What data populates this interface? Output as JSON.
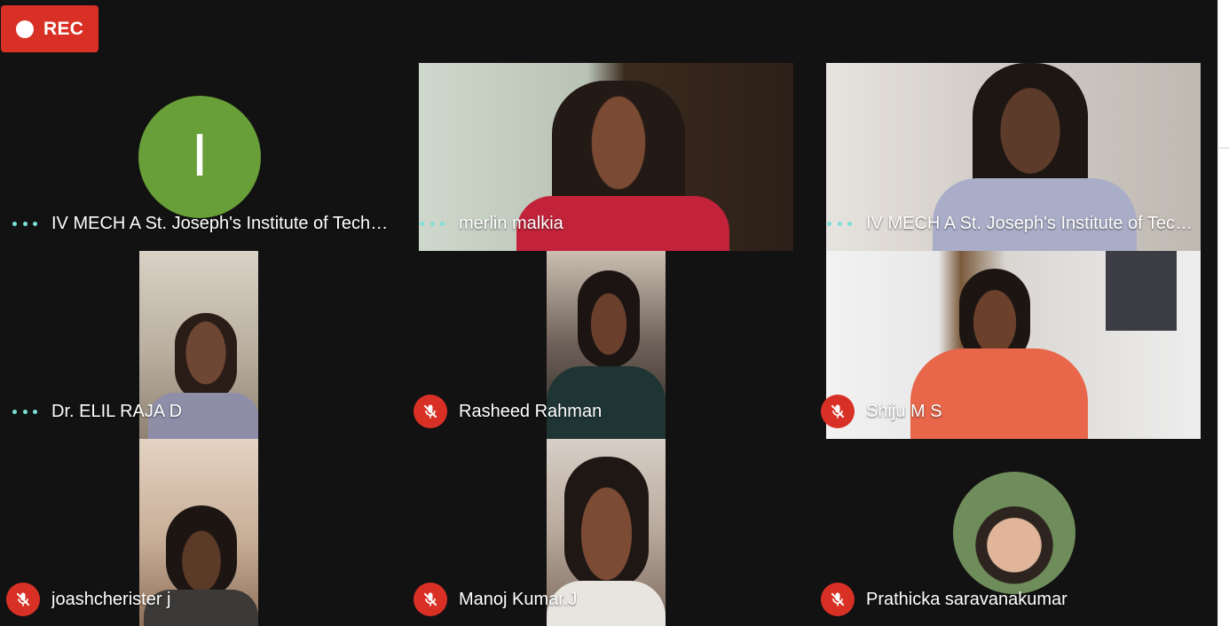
{
  "recording": {
    "label": "REC"
  },
  "tiles": [
    {
      "name": "IV MECH A St. Joseph's Institute of Technology",
      "control": "more",
      "avatar_letter": "I"
    },
    {
      "name": "merlin malkia",
      "control": "more"
    },
    {
      "name": "IV MECH A St. Joseph's Institute of Technology",
      "control": "more"
    },
    {
      "name": "Dr. ELIL RAJA D",
      "control": "more"
    },
    {
      "name": "Rasheed Rahman",
      "control": "mic-off"
    },
    {
      "name": "Shiju M S",
      "control": "mic-off"
    },
    {
      "name": "joashcherister j",
      "control": "mic-off"
    },
    {
      "name": "Manoj Kumar.J",
      "control": "mic-off"
    },
    {
      "name": "Prathicka saravanakumar",
      "control": "mic-off"
    }
  ],
  "colors": {
    "rec_red": "#d93025",
    "avatar_green": "#689f38",
    "menu_dots": "#7de0d6",
    "background": "#121212"
  }
}
